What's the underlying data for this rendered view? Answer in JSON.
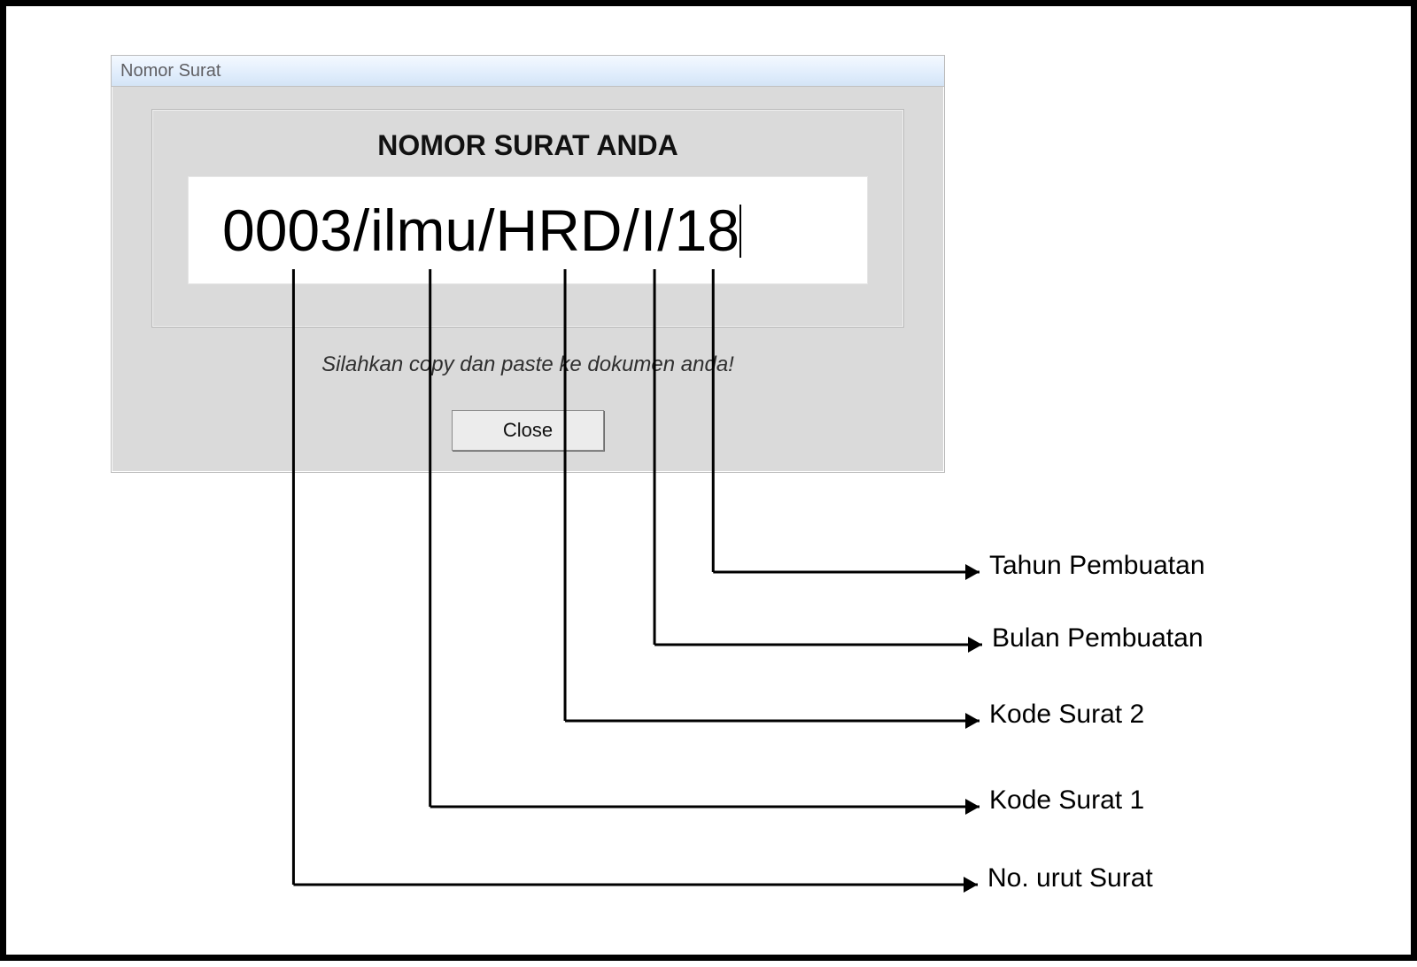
{
  "window": {
    "title": "Nomor Surat",
    "heading": "NOMOR SURAT ANDA",
    "hint": "Silahkan copy dan paste ke dokumen anda!",
    "close_label": "Close"
  },
  "letter_number": {
    "full": "0003/ilmu/HRD/I/18",
    "parts": {
      "seq": "0003",
      "code1": "ilmu",
      "code2": "HRD",
      "month": "I",
      "year": "18"
    }
  },
  "callouts": {
    "seq": "No. urut Surat",
    "code1": "Kode Surat 1",
    "code2": "Kode Surat 2",
    "month": "Bulan Pembuatan",
    "year": "Tahun Pembuatan"
  }
}
